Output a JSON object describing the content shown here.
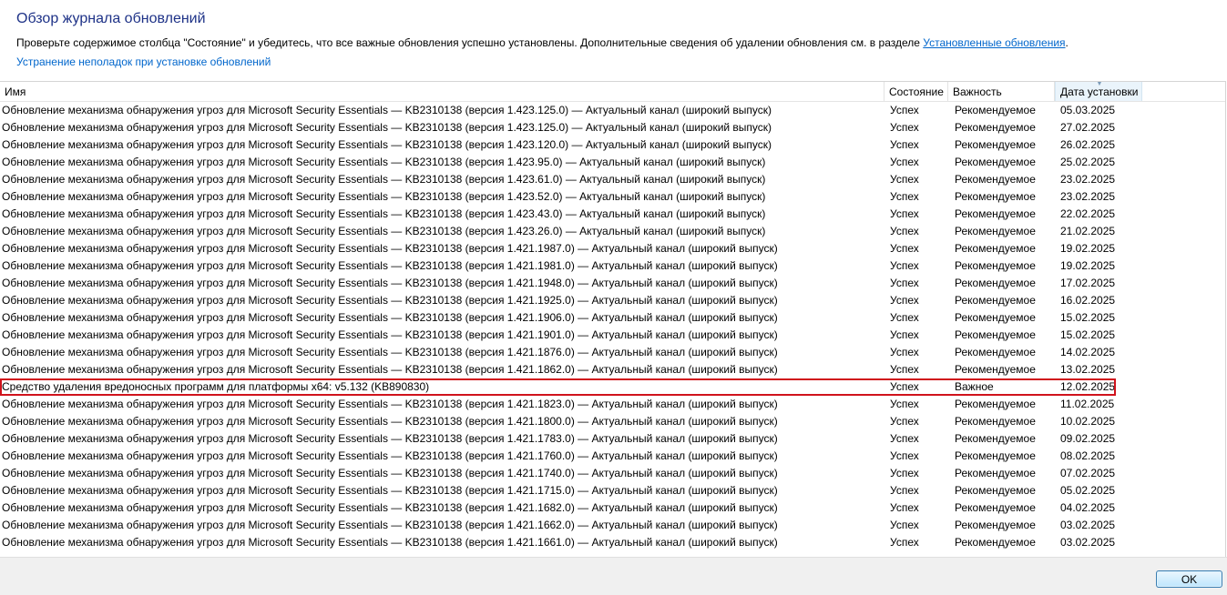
{
  "header": {
    "title": "Обзор журнала обновлений",
    "description": "Проверьте содержимое столбца \"Состояние\" и убедитесь, что все важные обновления успешно установлены. Дополнительные сведения об удалении обновления см. в разделе ",
    "installed_updates_link": "Установленные обновления",
    "description_end": ".",
    "troubleshoot_link": "Устранение неполадок при установке обновлений"
  },
  "table": {
    "columns": {
      "name": "Имя",
      "status": "Состояние",
      "importance": "Важность",
      "date": "Дата установки"
    },
    "sorted_column": "date",
    "highlighted_row": 16,
    "highlight_color": "#d0131c",
    "rows": [
      {
        "name": "Обновление механизма обнаружения угроз для Microsoft Security Essentials — KB2310138 (версия 1.423.125.0) — Актуальный канал (широкий выпуск)",
        "status": "Успех",
        "importance": "Рекомендуемое",
        "date": "05.03.2025"
      },
      {
        "name": "Обновление механизма обнаружения угроз для Microsoft Security Essentials — KB2310138 (версия 1.423.125.0) — Актуальный канал (широкий выпуск)",
        "status": "Успех",
        "importance": "Рекомендуемое",
        "date": "27.02.2025"
      },
      {
        "name": "Обновление механизма обнаружения угроз для Microsoft Security Essentials — KB2310138 (версия 1.423.120.0) — Актуальный канал (широкий выпуск)",
        "status": "Успех",
        "importance": "Рекомендуемое",
        "date": "26.02.2025"
      },
      {
        "name": "Обновление механизма обнаружения угроз для Microsoft Security Essentials — KB2310138 (версия 1.423.95.0) — Актуальный канал (широкий выпуск)",
        "status": "Успех",
        "importance": "Рекомендуемое",
        "date": "25.02.2025"
      },
      {
        "name": "Обновление механизма обнаружения угроз для Microsoft Security Essentials — KB2310138 (версия 1.423.61.0) — Актуальный канал (широкий выпуск)",
        "status": "Успех",
        "importance": "Рекомендуемое",
        "date": "23.02.2025"
      },
      {
        "name": "Обновление механизма обнаружения угроз для Microsoft Security Essentials — KB2310138 (версия 1.423.52.0) — Актуальный канал (широкий выпуск)",
        "status": "Успех",
        "importance": "Рекомендуемое",
        "date": "23.02.2025"
      },
      {
        "name": "Обновление механизма обнаружения угроз для Microsoft Security Essentials — KB2310138 (версия 1.423.43.0) — Актуальный канал (широкий выпуск)",
        "status": "Успех",
        "importance": "Рекомендуемое",
        "date": "22.02.2025"
      },
      {
        "name": "Обновление механизма обнаружения угроз для Microsoft Security Essentials — KB2310138 (версия 1.423.26.0) — Актуальный канал (широкий выпуск)",
        "status": "Успех",
        "importance": "Рекомендуемое",
        "date": "21.02.2025"
      },
      {
        "name": "Обновление механизма обнаружения угроз для Microsoft Security Essentials — KB2310138 (версия 1.421.1987.0) — Актуальный канал (широкий выпуск)",
        "status": "Успех",
        "importance": "Рекомендуемое",
        "date": "19.02.2025"
      },
      {
        "name": "Обновление механизма обнаружения угроз для Microsoft Security Essentials — KB2310138 (версия 1.421.1981.0) — Актуальный канал (широкий выпуск)",
        "status": "Успех",
        "importance": "Рекомендуемое",
        "date": "19.02.2025"
      },
      {
        "name": "Обновление механизма обнаружения угроз для Microsoft Security Essentials — KB2310138 (версия 1.421.1948.0) — Актуальный канал (широкий выпуск)",
        "status": "Успех",
        "importance": "Рекомендуемое",
        "date": "17.02.2025"
      },
      {
        "name": "Обновление механизма обнаружения угроз для Microsoft Security Essentials — KB2310138 (версия 1.421.1925.0) — Актуальный канал (широкий выпуск)",
        "status": "Успех",
        "importance": "Рекомендуемое",
        "date": "16.02.2025"
      },
      {
        "name": "Обновление механизма обнаружения угроз для Microsoft Security Essentials — KB2310138 (версия 1.421.1906.0) — Актуальный канал (широкий выпуск)",
        "status": "Успех",
        "importance": "Рекомендуемое",
        "date": "15.02.2025"
      },
      {
        "name": "Обновление механизма обнаружения угроз для Microsoft Security Essentials — KB2310138 (версия 1.421.1901.0) — Актуальный канал (широкий выпуск)",
        "status": "Успех",
        "importance": "Рекомендуемое",
        "date": "15.02.2025"
      },
      {
        "name": "Обновление механизма обнаружения угроз для Microsoft Security Essentials — KB2310138 (версия 1.421.1876.0) — Актуальный канал (широкий выпуск)",
        "status": "Успех",
        "importance": "Рекомендуемое",
        "date": "14.02.2025"
      },
      {
        "name": "Обновление механизма обнаружения угроз для Microsoft Security Essentials — KB2310138 (версия 1.421.1862.0) — Актуальный канал (широкий выпуск)",
        "status": "Успех",
        "importance": "Рекомендуемое",
        "date": "13.02.2025"
      },
      {
        "name": "Средство удаления вредоносных программ для платформы x64: v5.132 (KB890830)",
        "status": "Успех",
        "importance": "Важное",
        "date": "12.02.2025"
      },
      {
        "name": "Обновление механизма обнаружения угроз для Microsoft Security Essentials — KB2310138 (версия 1.421.1823.0) — Актуальный канал (широкий выпуск)",
        "status": "Успех",
        "importance": "Рекомендуемое",
        "date": "11.02.2025"
      },
      {
        "name": "Обновление механизма обнаружения угроз для Microsoft Security Essentials — KB2310138 (версия 1.421.1800.0) — Актуальный канал (широкий выпуск)",
        "status": "Успех",
        "importance": "Рекомендуемое",
        "date": "10.02.2025"
      },
      {
        "name": "Обновление механизма обнаружения угроз для Microsoft Security Essentials — KB2310138 (версия 1.421.1783.0) — Актуальный канал (широкий выпуск)",
        "status": "Успех",
        "importance": "Рекомендуемое",
        "date": "09.02.2025"
      },
      {
        "name": "Обновление механизма обнаружения угроз для Microsoft Security Essentials — KB2310138 (версия 1.421.1760.0) — Актуальный канал (широкий выпуск)",
        "status": "Успех",
        "importance": "Рекомендуемое",
        "date": "08.02.2025"
      },
      {
        "name": "Обновление механизма обнаружения угроз для Microsoft Security Essentials — KB2310138 (версия 1.421.1740.0) — Актуальный канал (широкий выпуск)",
        "status": "Успех",
        "importance": "Рекомендуемое",
        "date": "07.02.2025"
      },
      {
        "name": "Обновление механизма обнаружения угроз для Microsoft Security Essentials — KB2310138 (версия 1.421.1715.0) — Актуальный канал (широкий выпуск)",
        "status": "Успех",
        "importance": "Рекомендуемое",
        "date": "05.02.2025"
      },
      {
        "name": "Обновление механизма обнаружения угроз для Microsoft Security Essentials — KB2310138 (версия 1.421.1682.0) — Актуальный канал (широкий выпуск)",
        "status": "Успех",
        "importance": "Рекомендуемое",
        "date": "04.02.2025"
      },
      {
        "name": "Обновление механизма обнаружения угроз для Microsoft Security Essentials — KB2310138 (версия 1.421.1662.0) — Актуальный канал (широкий выпуск)",
        "status": "Успех",
        "importance": "Рекомендуемое",
        "date": "03.02.2025"
      },
      {
        "name": "Обновление механизма обнаружения угроз для Microsoft Security Essentials — KB2310138 (версия 1.421.1661.0) — Актуальный канал (широкий выпуск)",
        "status": "Успех",
        "importance": "Рекомендуемое",
        "date": "03.02.2025"
      }
    ]
  },
  "footer": {
    "ok_label": "OK"
  }
}
